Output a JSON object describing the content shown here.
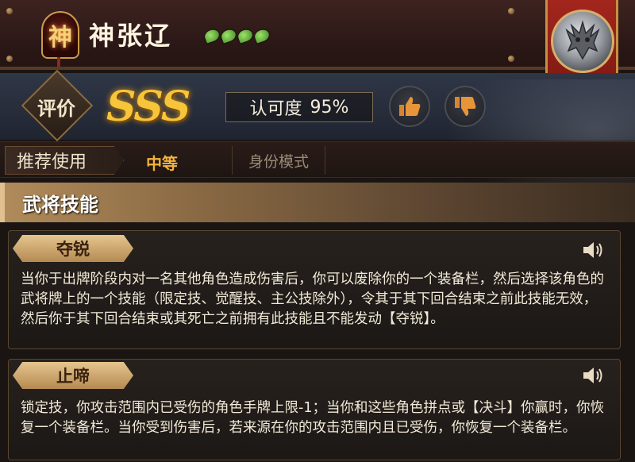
{
  "header": {
    "badge_char": "神",
    "general_name": "神张辽",
    "magatama_count": 4,
    "emblem_icon": "portrait-emblem"
  },
  "rating": {
    "eval_label": "评价",
    "grade": "SSS",
    "approval_label": "认可度",
    "approval_value": "95%",
    "like_icon": "thumbs-up-icon",
    "dislike_icon": "thumbs-down-icon"
  },
  "recommend": {
    "label": "推荐使用",
    "value": "中等",
    "mode": "身份模式"
  },
  "skills": {
    "header": "武将技能",
    "items": [
      {
        "name": "夺锐",
        "desc": "当你于出牌阶段内对一名其他角色造成伤害后，你可以废除你的一个装备栏，然后选择该角色的武将牌上的一个技能（限定技、觉醒技、主公技除外），令其于其下回合结束之前此技能无效，然后你于其下回合结束或其死亡之前拥有此技能且不能发动【夺锐】。"
      },
      {
        "name": "止啼",
        "desc": "锁定技，你攻击范围内已受伤的角色手牌上限-1；当你和这些角色拼点或【决斗】你赢时，你恢复一个装备栏。当你受到伤害后，若来源在你的攻击范围内且已受伤，你恢复一个装备栏。"
      }
    ]
  },
  "colors": {
    "grade_gold": "#f6c53a",
    "recommend_orange": "#f4b43a",
    "magatama_green": "#6cc23a",
    "banner_red": "#a3261d"
  }
}
